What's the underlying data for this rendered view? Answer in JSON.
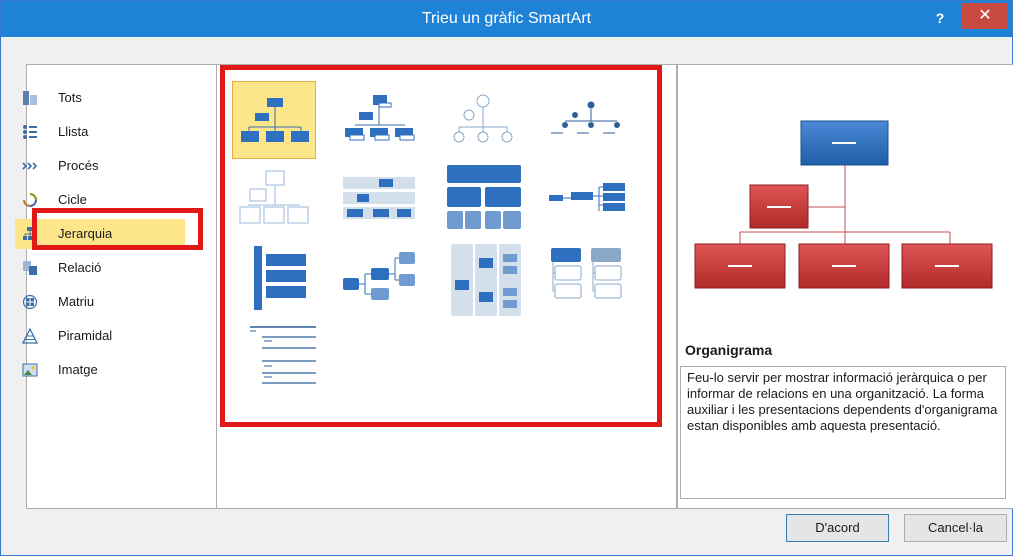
{
  "dialog": {
    "title": "Trieu un gràfic SmartArt",
    "help_label": "?",
    "close_label": "✕"
  },
  "categories": [
    {
      "label": "Tots",
      "icon": "all-icon"
    },
    {
      "label": "Llista",
      "icon": "list-icon"
    },
    {
      "label": "Procés",
      "icon": "process-icon"
    },
    {
      "label": "Cicle",
      "icon": "cycle-icon"
    },
    {
      "label": "Jerarquia",
      "icon": "hierarchy-icon",
      "selected": true
    },
    {
      "label": "Relació",
      "icon": "relationship-icon"
    },
    {
      "label": "Matriu",
      "icon": "matrix-icon"
    },
    {
      "label": "Piramidal",
      "icon": "pyramid-icon"
    },
    {
      "label": "Imatge",
      "icon": "picture-icon"
    }
  ],
  "gallery": {
    "selected_index": 0,
    "items": [
      "org-chart-thumb",
      "name-title-org-chart-thumb",
      "circle-picture-hierarchy-thumb",
      "hierarchy-dots-thumb",
      "hierarchy-outline-thumb",
      "table-hierarchy-thumb",
      "architecture-layout-thumb",
      "horizontal-hierarchy-thumb",
      "labeled-hierarchy-thumb",
      "horizontal-org-chart-thumb",
      "horizontal-multilevel-thumb",
      "hierarchy-list-thumb",
      "lined-list-thumb"
    ]
  },
  "preview": {
    "name": "Organigrama",
    "description": "Feu-lo servir per mostrar informació jeràrquica o per informar de relacions en una organització. La forma auxiliar i les presentacions dependents d'organigrama estan disponibles amb aquesta presentació."
  },
  "buttons": {
    "ok": "D'acord",
    "cancel": "Cancel·la"
  },
  "colors": {
    "titlebar": "#1e83d6",
    "highlight": "#e01818",
    "selection": "#fde68a",
    "preview_top": "#2f6fc0",
    "preview_child": "#c73a3a"
  }
}
